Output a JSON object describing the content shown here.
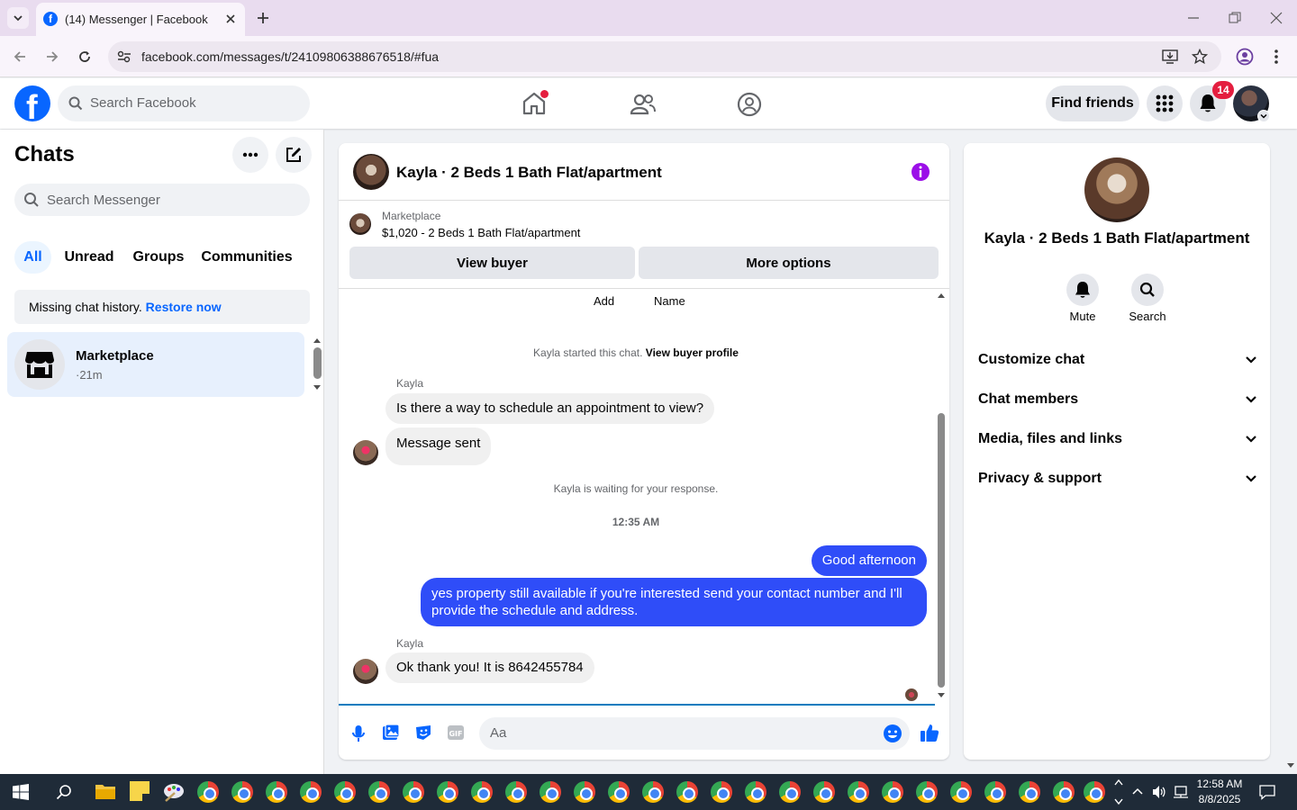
{
  "browser": {
    "tab_title": "(14) Messenger | Facebook",
    "url": "facebook.com/messages/t/24109806388676518/#fua"
  },
  "fb_header": {
    "search_placeholder": "Search Facebook",
    "find_friends": "Find friends",
    "notification_count": "14"
  },
  "chats": {
    "title": "Chats",
    "search_placeholder": "Search Messenger",
    "filters": [
      "All",
      "Unread",
      "Groups",
      "Communities"
    ],
    "missing_history": "Missing chat history.",
    "restore_link": "Restore now",
    "items": [
      {
        "name": "Marketplace",
        "meta": "·21m"
      }
    ]
  },
  "conversation": {
    "title": "Kayla · 2 Beds 1 Bath Flat/apartment",
    "listing": {
      "source": "Marketplace",
      "detail": "$1,020 - 2 Beds 1 Bath Flat/apartment",
      "view_buyer": "View buyer",
      "more_options": "More options"
    },
    "top_actions": [
      "Add",
      "Name"
    ],
    "started_text": "Kayla started this chat.",
    "view_buyer_profile": "View buyer profile",
    "sender_name": "Kayla",
    "messages_in_1": [
      "Is there a way to schedule an appointment to view?",
      "Message sent"
    ],
    "waiting_text": "Kayla is waiting for your response.",
    "timestamp": "12:35 AM",
    "messages_out": [
      "Good afternoon",
      "yes property still available if you're interested send your contact number and I'll provide the schedule and address."
    ],
    "message_in_2": "Ok thank you! It is 8642455784",
    "composer_placeholder": "Aa"
  },
  "details": {
    "name": "Kayla · 2 Beds 1 Bath Flat/apartment",
    "mute": "Mute",
    "search": "Search",
    "sections": [
      "Customize chat",
      "Chat members",
      "Media, files and links",
      "Privacy & support"
    ]
  },
  "taskbar": {
    "time": "12:58 AM",
    "date": "8/8/2025"
  },
  "colors": {
    "fb_blue": "#0866ff",
    "outgoing_bubble": "#2f4df8",
    "badge_red": "#e41e3f",
    "selected_chat_bg": "#e7f0fd"
  }
}
